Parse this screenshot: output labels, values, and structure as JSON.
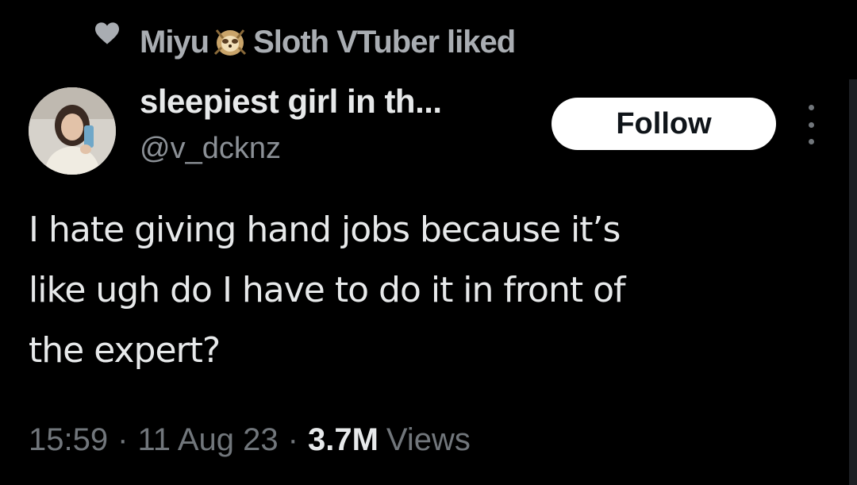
{
  "social_context": {
    "liker_name": "Miyu",
    "liker_suffix": "Sloth VTuber",
    "action": "liked",
    "icon": "heart-icon",
    "emoji_icon": "sloth-icon"
  },
  "author": {
    "display_name": "sleepiest girl in th...",
    "handle": "@v_dcknz",
    "avatar": "avatar"
  },
  "follow_label": "Follow",
  "more_icon": "more-vertical-icon",
  "tweet_lines": [
    "I hate giving hand jobs because it’s",
    "like ugh do I have to do it in front of",
    "the expert?"
  ],
  "meta": {
    "time": "15:59",
    "separator": "·",
    "date": "11 Aug 23",
    "views_count": "3.7M",
    "views_label": "Views"
  },
  "colors": {
    "background": "#000000",
    "primary_text": "#e7e9ea",
    "secondary_text": "#71767b",
    "follow_bg": "#ffffff"
  }
}
